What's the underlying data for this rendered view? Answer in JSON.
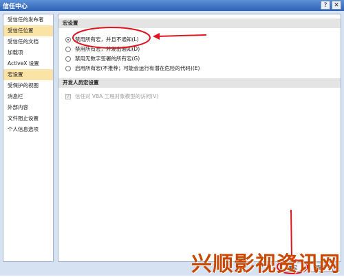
{
  "window": {
    "title": "信任中心",
    "help_label": "?",
    "close_label": "✕"
  },
  "sidebar": {
    "items": [
      {
        "label": "受信任的发布者",
        "selected": false
      },
      {
        "label": "受信任位置",
        "selected": true
      },
      {
        "label": "受信任的文档",
        "selected": false
      },
      {
        "label": "加载项",
        "selected": false
      },
      {
        "label": "ActiveX 设置",
        "selected": false
      },
      {
        "label": "宏设置",
        "selected": true
      },
      {
        "label": "受保护的视图",
        "selected": false
      },
      {
        "label": "消息栏",
        "selected": false
      },
      {
        "label": "外部内容",
        "selected": false
      },
      {
        "label": "文件阻止设置",
        "selected": false
      },
      {
        "label": "个人信息选项",
        "selected": false
      }
    ]
  },
  "macro": {
    "heading": "宏设置",
    "options": [
      {
        "label": "禁用所有宏，并且不通知(L)",
        "selected": true
      },
      {
        "label": "禁用所有宏，并发出通知(D)",
        "selected": false
      },
      {
        "label": "禁用无数字签署的所有宏(G)",
        "selected": false
      },
      {
        "label": "启用所有宏(不推荐；可能会运行有潜在危险的代码)(E)",
        "selected": false
      }
    ]
  },
  "dev": {
    "heading": "开发人员宏设置",
    "vba_label": "信任对 VBA 工程对象模型的访问(V)",
    "vba_checked": true
  },
  "buttons": {
    "ok": "确定",
    "cancel": "取消"
  },
  "watermark": "兴顺影视资讯网",
  "colors": {
    "annotation": "#e0141e",
    "title_bar": "#2f63b3",
    "selected": "#fbe3a5"
  }
}
